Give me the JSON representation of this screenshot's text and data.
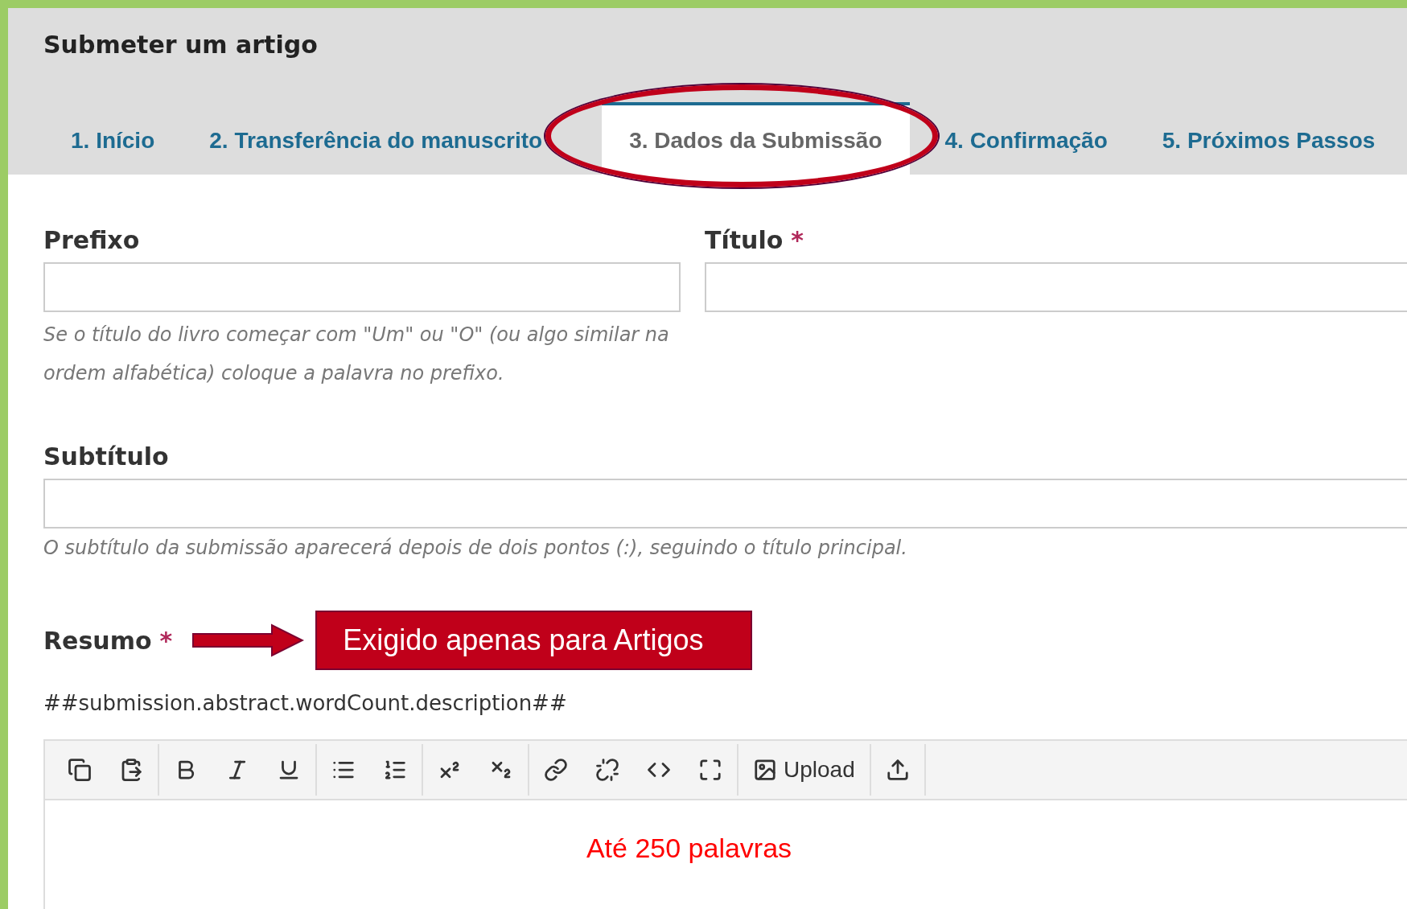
{
  "header": {
    "title": "Submeter um artigo"
  },
  "tabs": [
    {
      "label": "1. Início",
      "selected": false
    },
    {
      "label": "2. Transferência do manuscrito",
      "selected": false
    },
    {
      "label": "3. Dados da Submissão",
      "selected": true
    },
    {
      "label": "4. Confirmação",
      "selected": false
    },
    {
      "label": "5. Próximos Passos",
      "selected": false
    }
  ],
  "fields": [
    {
      "label": "Prefixo",
      "help": "Se o título do livro começar com \"Um\" ou \"O\" (ou algo similar na ordem alfabética) coloque a palavra no prefixo."
    },
    {
      "label": "Título",
      "required_mark": "*"
    }
  ],
  "subtitle": {
    "label": "Subtítulo",
    "help": "O subtítulo da submissão aparecerá depois de dois pontos (:), seguindo o título principal."
  },
  "abstract": {
    "label": "Resumo",
    "required_mark": "*",
    "callout": "Exigido apenas para Artigos",
    "description": "##submission.abstract.wordCount.description##",
    "toolbar": [
      [
        {
          "kind": "copy"
        },
        {
          "kind": "paste"
        }
      ],
      [
        {
          "kind": "bold"
        },
        {
          "kind": "italic"
        },
        {
          "kind": "underline"
        }
      ],
      [
        {
          "kind": "bullets"
        },
        {
          "kind": "numbers"
        }
      ],
      [
        {
          "kind": "superscript"
        },
        {
          "kind": "subscript"
        }
      ],
      [
        {
          "kind": "link"
        },
        {
          "kind": "unlink"
        },
        {
          "kind": "code"
        },
        {
          "kind": "fullscreen"
        }
      ],
      [
        {
          "kind": "upload",
          "label": "Upload"
        }
      ],
      [
        {
          "kind": "import"
        }
      ]
    ],
    "editor_note": "Até 250 palavras"
  }
}
